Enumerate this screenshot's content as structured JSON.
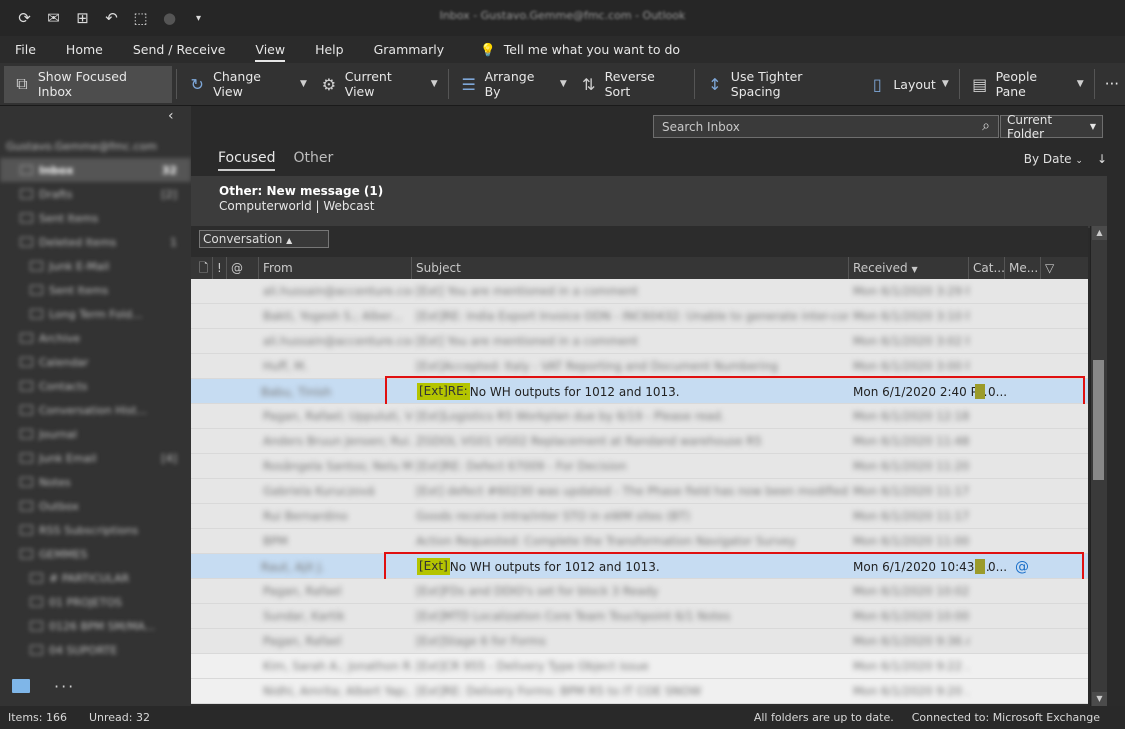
{
  "titlebar": {
    "title": "Inbox - Gustavo.Gemme@fmc.com - Outlook",
    "icons": [
      "sync-icon",
      "mail-icon",
      "inbox-filter-icon",
      "undo-icon",
      "touch-icon",
      "circle-icon",
      "dropdown-icon"
    ]
  },
  "menu": {
    "items": [
      "File",
      "Home",
      "Send / Receive",
      "View",
      "Help",
      "Grammarly"
    ],
    "active": "View",
    "tell": "Tell me what you want to do"
  },
  "ribbon": {
    "show_focused": "Show Focused Inbox",
    "change_view": "Change View",
    "current_view": "Current View",
    "arrange_by": "Arrange By",
    "reverse_sort": "Reverse Sort",
    "tighter": "Use Tighter Spacing",
    "layout": "Layout",
    "people_pane": "People Pane",
    "more": "···"
  },
  "sidebar": {
    "account": "Gustavo.Gemme@fmc.com",
    "items": [
      {
        "label": "Inbox",
        "count": "32",
        "sel": true
      },
      {
        "label": "Drafts",
        "count": "[2]"
      },
      {
        "label": "Sent Items",
        "count": ""
      },
      {
        "label": "Deleted Items",
        "count": "1"
      },
      {
        "label": "Junk E-Mail",
        "count": ""
      },
      {
        "label": "Sent Items",
        "count": ""
      },
      {
        "label": "Long Term Fold...",
        "count": ""
      },
      {
        "label": "Archive",
        "count": ""
      },
      {
        "label": "Calendar",
        "count": ""
      },
      {
        "label": "Contacts",
        "count": ""
      },
      {
        "label": "Conversation Hist...",
        "count": ""
      },
      {
        "label": "Journal",
        "count": ""
      },
      {
        "label": "Junk Email",
        "count": "[4]"
      },
      {
        "label": "Notes",
        "count": ""
      },
      {
        "label": "Outbox",
        "count": ""
      },
      {
        "label": "RSS Subscriptions",
        "count": ""
      },
      {
        "label": "GEMMES",
        "count": ""
      },
      {
        "label": "# PARTICULAR",
        "count": ""
      },
      {
        "label": "01 PROJETOS",
        "count": ""
      },
      {
        "label": "0126 BPM SM/MA...",
        "count": ""
      },
      {
        "label": "04 SUPORTE",
        "count": ""
      }
    ]
  },
  "search": {
    "placeholder": "Search Inbox",
    "scope": "Current Folder"
  },
  "tabs": {
    "focused": "Focused",
    "other": "Other"
  },
  "sort": {
    "label": "By Date"
  },
  "other_notice": {
    "line1": "Other: New message (1)",
    "line2": "Computerworld | Webcast"
  },
  "conversation": "Conversation",
  "columns": {
    "from": "From",
    "subject": "Subject",
    "received": "Received",
    "cat": "Cat...",
    "men": "Me..."
  },
  "rows": [
    {
      "from": "ali.hussain@accenture.com",
      "subject": "[Ext] You are mentioned in a comment",
      "received": "Mon 6/1/2020 3:29 P...",
      "bg": "light"
    },
    {
      "from": "Bakti, Yogesh S.; Alber...",
      "subject": "[Ext]RE: India Export Invoice ODN - INC60432: Unable to generate inter-compan...",
      "received": "Mon 6/1/2020 3:10 P...",
      "bg": "light"
    },
    {
      "from": "ali.hussain@accenture.com",
      "subject": "[Ext] You are mentioned in a comment",
      "received": "Mon 6/1/2020 3:02 P...",
      "bg": "light"
    },
    {
      "from": "Huff, M.",
      "subject": "[Ext]Accepted: Italy - VAT Reporting and Document Numbering",
      "received": "Mon 6/1/2020 3:00 P...",
      "bg": "light"
    },
    {
      "from": "Babu, Tinish",
      "subject": "No WH outputs for 1012 and 1013.",
      "tag": "[Ext]RE:",
      "received": "Mon 6/1/2020 2:40 P...",
      "men": "0...",
      "bg": "hl"
    },
    {
      "from": "Pagan, Rafael; Uppuluti, V...",
      "subject": "[Ext]Logistics R5 Workplan due by 6/19 - Please read.",
      "received": "Mon 6/1/2020 12:18 ...",
      "bg": "light"
    },
    {
      "from": "Anders Bruun Jensen; Rui...",
      "subject": "ZGDOL VG01 VG02 Replacement at Randand warehouse R5",
      "received": "Mon 6/1/2020 11:48 ...",
      "bg": "light"
    },
    {
      "from": "Rosângela Santos; Nelu M...",
      "subject": "[Ext]RE: Defect 67009 - For Decision",
      "received": "Mon 6/1/2020 11:20 ...",
      "bg": "light"
    },
    {
      "from": "Gabriela Kuruczová",
      "subject": "[Ext] defect #60230 was updated - The Phase field has now been modified",
      "received": "Mon 6/1/2020 11:17 ...",
      "bg": "light"
    },
    {
      "from": "Rui Bernardino",
      "subject": "Goods receive intra/inter STO in eWM sites (BT)",
      "received": "Mon 6/1/2020 11:17 ...",
      "bg": "light"
    },
    {
      "from": "BPM",
      "subject": "Action Requested: Complete the Transformation Navigator Survey",
      "received": "Mon 6/1/2020 11:00 ...",
      "bg": "light"
    },
    {
      "from": "Raut, Ajit J.",
      "subject": "No WH outputs for 1012 and 1013.",
      "tag": "[Ext]",
      "received": "Mon 6/1/2020 10:43 ...",
      "men": "0...",
      "at": true,
      "bg": "hl"
    },
    {
      "from": "Pagan, Rafael",
      "subject": "[Ext]FDs and DDIO's set for block 3 Ready",
      "received": "Mon 6/1/2020 10:02 ...",
      "bg": "light"
    },
    {
      "from": "Sundar, Kartik",
      "subject": "[Ext]MTD Localization Core Team Touchpoint 6/1 Notes",
      "received": "Mon 6/1/2020 10:00 ...",
      "bg": "light"
    },
    {
      "from": "Pagan, Rafael",
      "subject": "[Ext]Stage 6 for Forms",
      "received": "Mon 6/1/2020 9:36 AM",
      "bg": "light"
    },
    {
      "from": "Kim, Sarah A.; Jonathon R...",
      "subject": "[Ext]CR 955 - Delivery Type Object issue",
      "received": "Mon 6/1/2020 9:22 ...",
      "bg": "white"
    },
    {
      "from": "Nidhi, Amrita; Albert Yap;...",
      "subject": "[Ext]RE: Delivery Forms: BPM R5 to IT COE SNOW",
      "received": "Mon 6/1/2020 9:20 ...",
      "bg": "white"
    }
  ],
  "status": {
    "items": "Items: 166",
    "unread": "Unread: 32",
    "sync": "All folders are up to date.",
    "conn": "Connected to: Microsoft Exchange"
  }
}
